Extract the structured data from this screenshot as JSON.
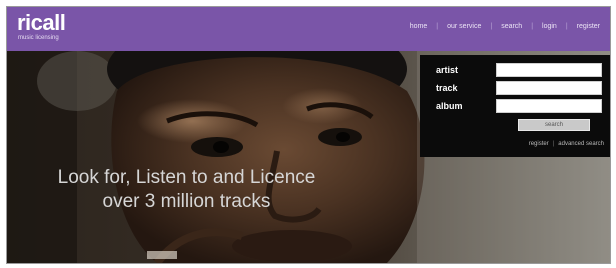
{
  "brand": {
    "name": "ricall",
    "tagline": "music licensing"
  },
  "nav": {
    "items": [
      "home",
      "our service",
      "search",
      "login",
      "register"
    ]
  },
  "hero": {
    "line1": "Look for, Listen to and Licence",
    "line2": "over 3 million tracks"
  },
  "search": {
    "fields": [
      {
        "label": "artist",
        "value": ""
      },
      {
        "label": "track",
        "value": ""
      },
      {
        "label": "album",
        "value": ""
      }
    ],
    "button_label": "search",
    "links": [
      "register",
      "advanced search"
    ]
  },
  "colors": {
    "header": "#7a55a8",
    "panel": "#0b0b0b"
  }
}
